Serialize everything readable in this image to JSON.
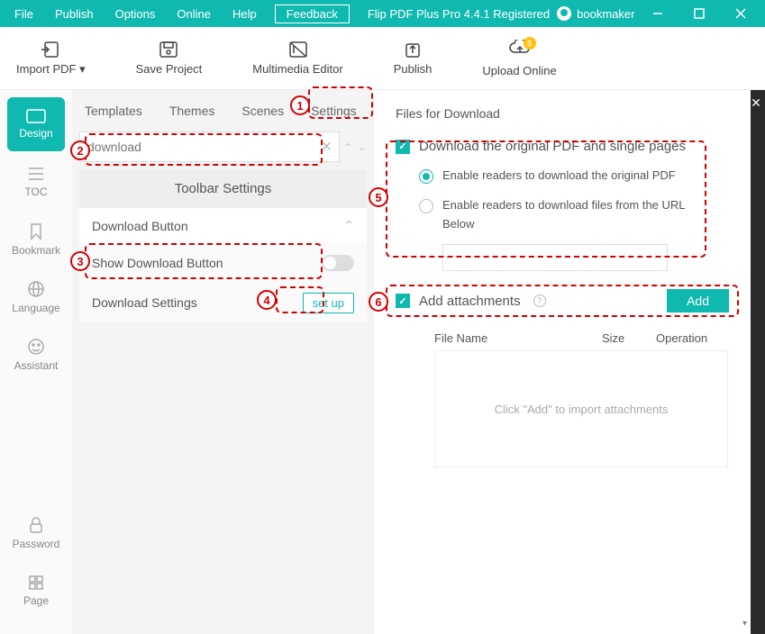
{
  "titlebar": {
    "menus": [
      "File",
      "Publish",
      "Options",
      "Online",
      "Help"
    ],
    "feedback": "Feedback",
    "appTitle": "Flip PDF Plus Pro 4.4.1 Registered",
    "username": "bookmaker"
  },
  "mainToolbar": {
    "importPdf": "Import PDF ▾",
    "saveProject": "Save Project",
    "multimediaEditor": "Multimedia Editor",
    "publish": "Publish",
    "uploadOnline": "Upload Online"
  },
  "sidebar": {
    "items": [
      "Design",
      "TOC",
      "Bookmark",
      "Language",
      "Assistant",
      "Password",
      "Page"
    ]
  },
  "tabs": [
    "Templates",
    "Themes",
    "Scenes",
    "Settings"
  ],
  "search": {
    "value": "download"
  },
  "settingsPanel": {
    "toolbarSettings": "Toolbar Settings",
    "downloadButton": "Download Button",
    "showDownloadButton": "Show Download Button",
    "downloadSettings": "Download Settings",
    "setup": "set up"
  },
  "right": {
    "title": "Files for Download",
    "chk1": "Download the original PDF and single pages",
    "radio1": "Enable readers to download the original PDF",
    "radio2": "Enable readers to download files from the URL Below",
    "chk2": "Add attachments",
    "addBtn": "Add",
    "table": {
      "fileName": "File Name",
      "size": "Size",
      "operation": "Operation",
      "empty": "Click \"Add\" to import attachments"
    }
  },
  "annotations": [
    "1",
    "2",
    "3",
    "4",
    "5",
    "6"
  ]
}
